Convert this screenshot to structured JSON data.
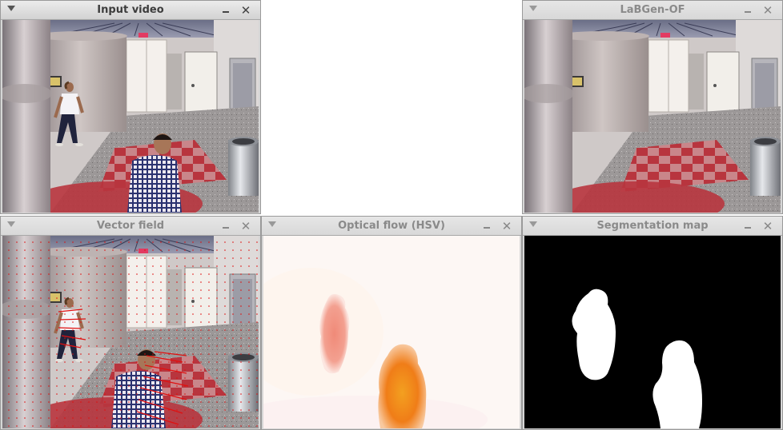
{
  "windows": {
    "input_video": {
      "title": "Input video",
      "close_glyph": "✕"
    },
    "labgen": {
      "title": "LaBGen-OF",
      "close_glyph": "✕"
    },
    "vector_field": {
      "title": "Vector field",
      "close_glyph": "✕"
    },
    "optical_flow": {
      "title": "Optical flow (HSV)",
      "close_glyph": "✕"
    },
    "segmentation": {
      "title": "Segmentation map",
      "close_glyph": "✕"
    }
  },
  "icons": {
    "menu": "window-menu-icon",
    "minimize": "minimize-icon",
    "close": "close-icon"
  },
  "colors": {
    "titlebar": "#dedede",
    "flow_background": "#fdf7f4",
    "flow_person_1": "#f2907a",
    "flow_person_2": "#f08a1c",
    "segmentation_bg": "#000000",
    "segmentation_fg": "#ffffff",
    "vector_color": "#e01010"
  },
  "scenes": {
    "input_video": "hallway-scene-with-two-people",
    "labgen": "hallway-background-estimate",
    "vector_field": "hallway-scene-with-motion-vectors"
  }
}
